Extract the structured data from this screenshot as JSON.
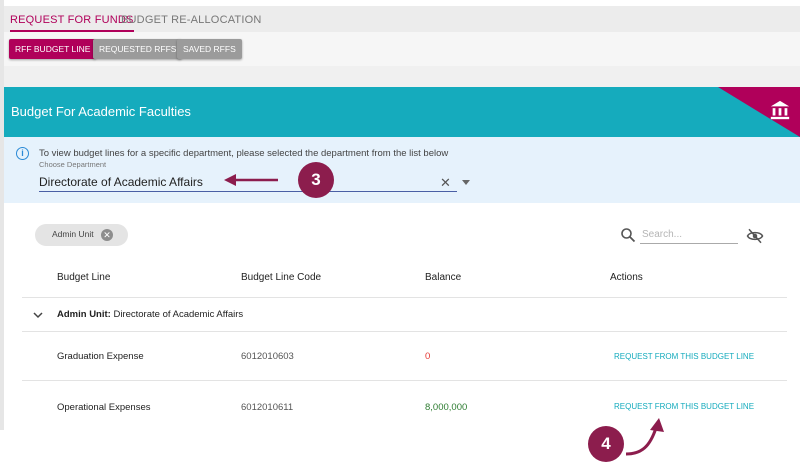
{
  "tabs": [
    {
      "label": "REQUEST FOR FUNDS",
      "active": true
    },
    {
      "label": "BUDGET RE-ALLOCATION",
      "active": false
    }
  ],
  "subtabs": [
    {
      "label": "RFF BUDGET LINE",
      "active": true
    },
    {
      "label": "REQUESTED RFFS",
      "active": false
    },
    {
      "label": "SAVED RFFS",
      "active": false
    }
  ],
  "header": {
    "title": "Budget For Academic Faculties",
    "icon": "bank-icon"
  },
  "info": {
    "text": "To view budget lines for a specific department, please selected the department from the list below",
    "field_label": "Choose Department",
    "field_value": "Directorate of Academic Affairs"
  },
  "callouts": {
    "step3": "3",
    "step4": "4"
  },
  "filter_chip": {
    "label": "Admin Unit"
  },
  "search": {
    "placeholder": "Search..."
  },
  "table": {
    "headers": [
      "Budget Line",
      "Budget Line Code",
      "Balance",
      "Actions"
    ],
    "group": {
      "label": "Admin Unit:",
      "value": "Directorate of Academic Affairs"
    },
    "rows": [
      {
        "name": "Graduation Expense",
        "code": "6012010603",
        "balance": "0",
        "action": "REQUEST FROM THIS BUDGET LINE"
      },
      {
        "name": "Operational Expenses",
        "code": "6012010611",
        "balance": "8,000,000",
        "action": "REQUEST FROM THIS BUDGET LINE"
      }
    ]
  },
  "colors": {
    "accent": "#b0005a",
    "teal": "#15abbd",
    "callout": "#8c1d4d",
    "zero_balance": "#e53935",
    "positive_balance": "#2e7d32"
  }
}
